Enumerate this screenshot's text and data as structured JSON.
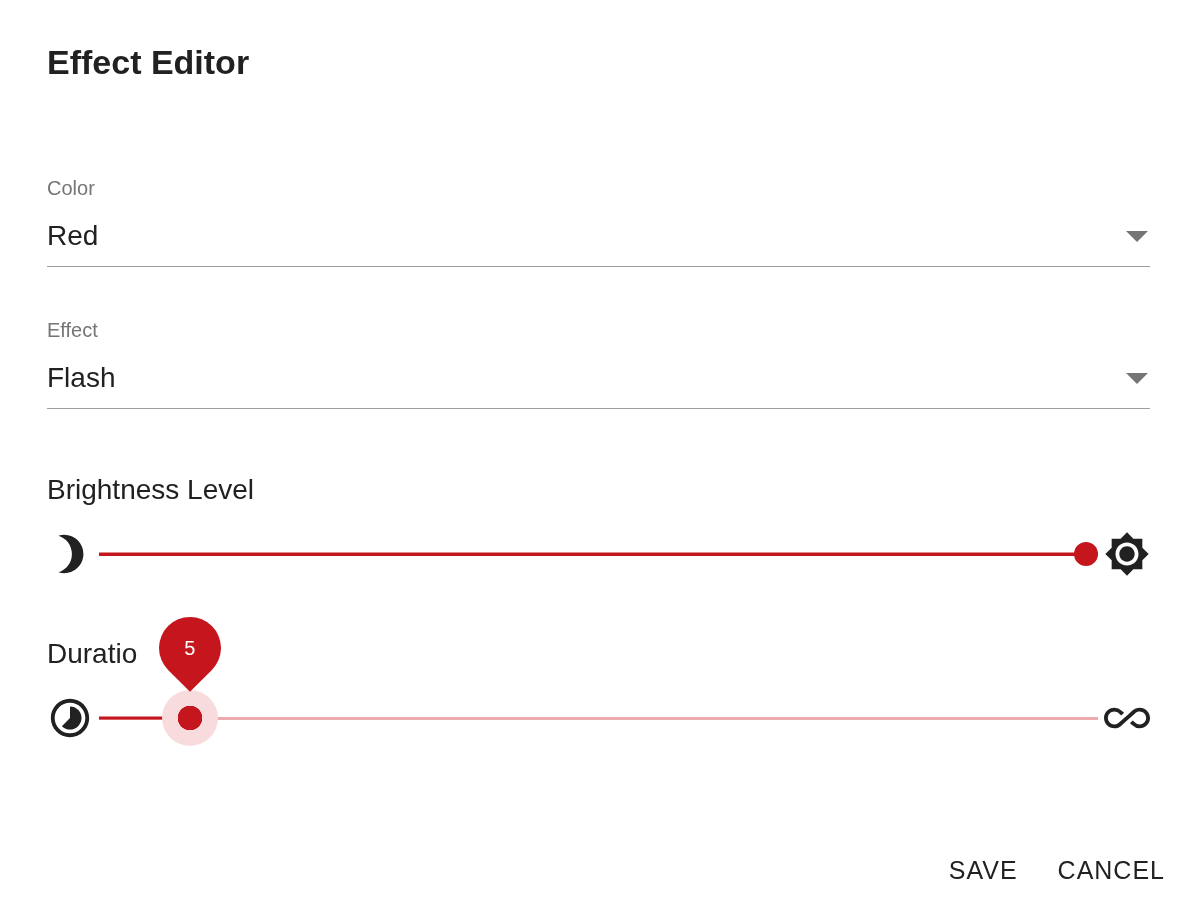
{
  "dialog": {
    "title": "Effect Editor"
  },
  "fields": [
    {
      "label": "Color",
      "value": "Red"
    },
    {
      "label": "Effect",
      "value": "Flash"
    }
  ],
  "sliders": [
    {
      "label": "Brightness Level",
      "level": 1
    },
    {
      "label": "Duratio",
      "level": 0.067,
      "value_label": "5"
    }
  ],
  "buttons": [
    "SAVE",
    "CANCEL"
  ]
}
